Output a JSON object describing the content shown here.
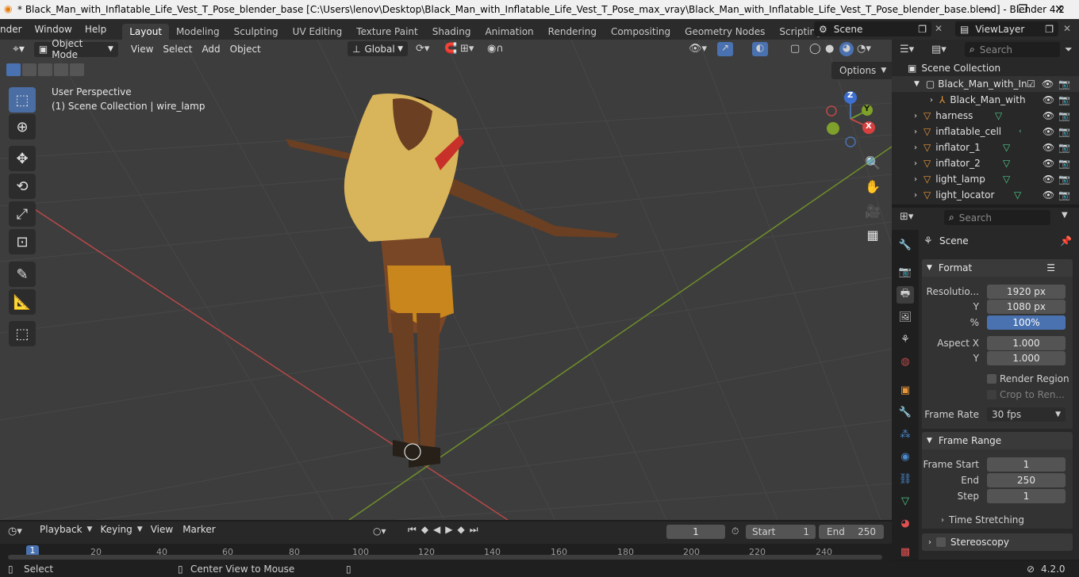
{
  "window": {
    "title": "* Black_Man_with_Inflatable_Life_Vest_T_Pose_blender_base [C:\\Users\\lenov\\Desktop\\Black_Man_with_Inflatable_Life_Vest_T_Pose_max_vray\\Black_Man_with_Inflatable_Life_Vest_T_Pose_blender_base.blend] - Blender 4.2",
    "minimize": "—",
    "maximize": "❐",
    "close": "✕"
  },
  "menubar": {
    "items": [
      "nder",
      "Window",
      "Help"
    ],
    "workspaces": [
      "Layout",
      "Modeling",
      "Sculpting",
      "UV Editing",
      "Texture Paint",
      "Shading",
      "Animation",
      "Rendering",
      "Compositing",
      "Geometry Nodes",
      "Scripting"
    ],
    "add_tab": "+",
    "scene": "Scene",
    "view_layer": "ViewLayer"
  },
  "viewport": {
    "mode": "Object Mode",
    "menus": [
      "View",
      "Select",
      "Add",
      "Object"
    ],
    "transform_orientation": "Global",
    "options": "Options",
    "info_line1": "User Perspective",
    "info_line2": "(1) Scene Collection | wire_lamp",
    "gizmo": {
      "z": "Z",
      "y": "Y",
      "x": "X"
    }
  },
  "outliner": {
    "search_placeholder": "Search",
    "root": "Scene Collection",
    "rows": [
      {
        "name": "Black_Man_with_In",
        "indent": 0
      },
      {
        "name": "Black_Man_with",
        "indent": 1
      },
      {
        "name": "harness",
        "indent": 0
      },
      {
        "name": "inflatable_cell",
        "indent": 0
      },
      {
        "name": "inflator_1",
        "indent": 0
      },
      {
        "name": "inflator_2",
        "indent": 0
      },
      {
        "name": "light_lamp",
        "indent": 0
      },
      {
        "name": "light_locator",
        "indent": 0
      }
    ]
  },
  "properties": {
    "search_placeholder": "Search",
    "context": "Scene",
    "format": {
      "title": "Format",
      "resolution_label": "Resolutio...",
      "res_x": "1920 px",
      "y_label": "Y",
      "res_y": "1080 px",
      "pct_label": "%",
      "pct": "100%",
      "pct_value": 1.0,
      "aspect_label": "Aspect X",
      "aspect_x": "1.000",
      "aspect_y_label": "Y",
      "aspect_y": "1.000",
      "render_region": "Render Region",
      "crop": "Crop to Ren...",
      "frame_rate_label": "Frame Rate",
      "frame_rate": "30 fps"
    },
    "frame_range": {
      "title": "Frame Range",
      "start_label": "Frame Start",
      "start": "1",
      "end_label": "End",
      "end": "250",
      "step_label": "Step",
      "step": "1"
    },
    "time_stretching": "Time Stretching",
    "stereoscopy": "Stereoscopy"
  },
  "timeline": {
    "menus": [
      "Playback",
      "Keying",
      "View",
      "Marker"
    ],
    "current_frame": "1",
    "start_label": "Start",
    "start": "1",
    "end_label": "End",
    "end": "250",
    "ticks": [
      "1",
      "20",
      "40",
      "60",
      "80",
      "100",
      "120",
      "140",
      "160",
      "180",
      "200",
      "220",
      "240"
    ]
  },
  "statusbar": {
    "select": "Select",
    "center": "Center View to Mouse",
    "version": "4.2.0"
  },
  "colors": {
    "accent": "#4a72b0",
    "viewport_bg": "#3d3d3d",
    "panel_bg": "#282828",
    "x_axis": "#c04848",
    "y_axis": "#7a9a2a"
  }
}
